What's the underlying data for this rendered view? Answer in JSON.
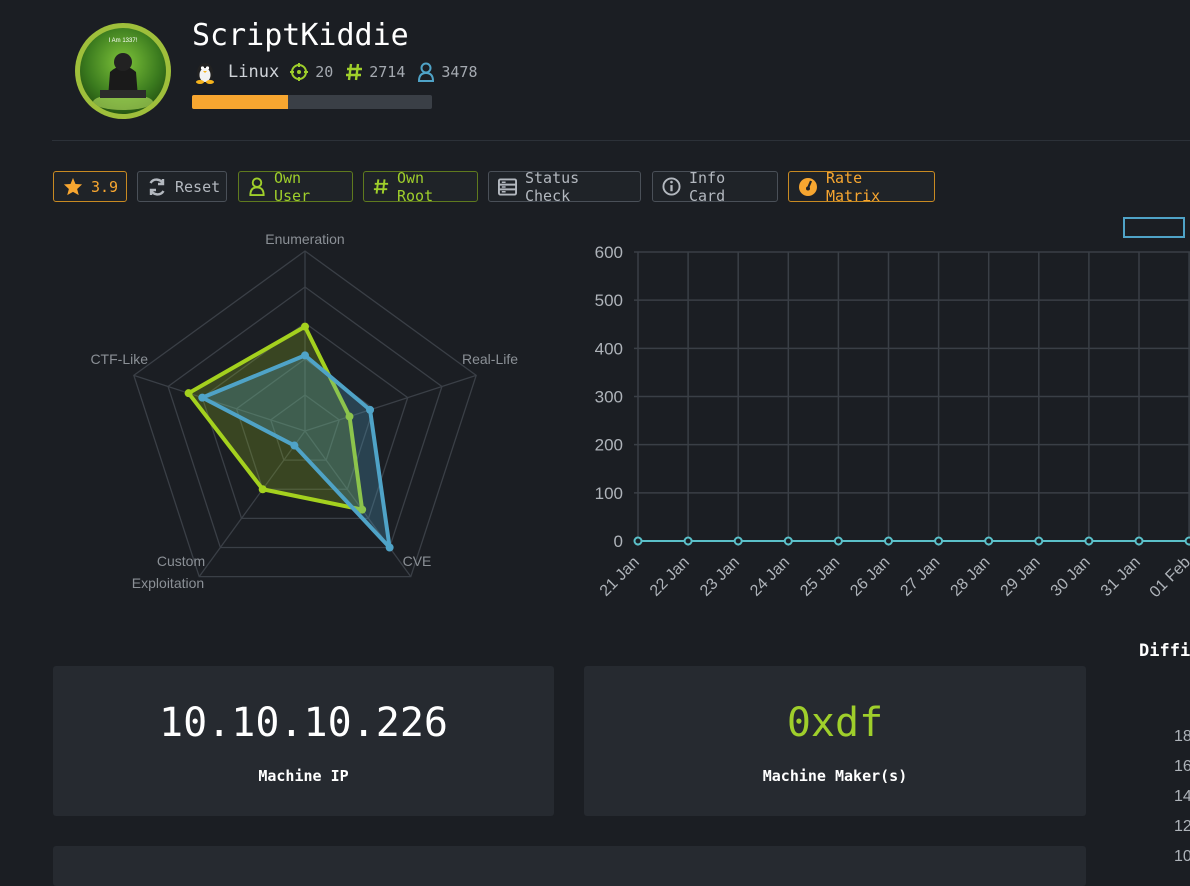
{
  "machine": {
    "name": "ScriptKiddie",
    "os": "Linux",
    "points": "20",
    "root_owns": "2714",
    "user_owns": "3478",
    "progress_fraction": 0.4,
    "avatar_text": "I Am 1337!"
  },
  "toolbar": {
    "rating": "3.9",
    "reset_label": "Reset",
    "own_user_label": "Own User",
    "own_root_label": "Own Root",
    "status_check_label": "Status Check",
    "info_card_label": "Info Card",
    "rate_matrix_label": "Rate Matrix"
  },
  "cards": {
    "ip_value": "10.10.10.226",
    "ip_label": "Machine IP",
    "maker_value": "0xdf",
    "maker_label": "Machine Maker(s)"
  },
  "difficulty": {
    "title_partial": "Diffi",
    "axis_partial": [
      "18",
      "16",
      "14",
      "12",
      "10"
    ]
  },
  "colors": {
    "accent_green": "#9fcf2b",
    "accent_orange": "#f7a630",
    "accent_blue": "#4fa3c7",
    "background": "#1b1e23",
    "card": "#262a30"
  },
  "chart_data": [
    {
      "type": "radar",
      "axes": [
        "Enumeration",
        "Real-Life",
        "CVE",
        "Custom Exploitation",
        "CTF-Like"
      ],
      "max": 5,
      "series": [
        {
          "color": "#a4d11e",
          "values": [
            2.9,
            1.3,
            2.7,
            2.0,
            3.4
          ]
        },
        {
          "color": "#4fa3c7",
          "values": [
            2.1,
            1.9,
            4.0,
            0.5,
            3.0
          ]
        }
      ]
    },
    {
      "type": "line",
      "x": [
        "21 Jan",
        "22 Jan",
        "23 Jan",
        "24 Jan",
        "25 Jan",
        "26 Jan",
        "27 Jan",
        "28 Jan",
        "29 Jan",
        "30 Jan",
        "31 Jan",
        "01 Feb"
      ],
      "series": [
        {
          "color": "#5bc0c9",
          "values": [
            0,
            0,
            0,
            0,
            0,
            0,
            0,
            0,
            0,
            0,
            0,
            0
          ]
        }
      ],
      "ylim": [
        0,
        600
      ],
      "yticks": [
        0,
        100,
        200,
        300,
        400,
        500,
        600
      ],
      "grid": true
    }
  ]
}
